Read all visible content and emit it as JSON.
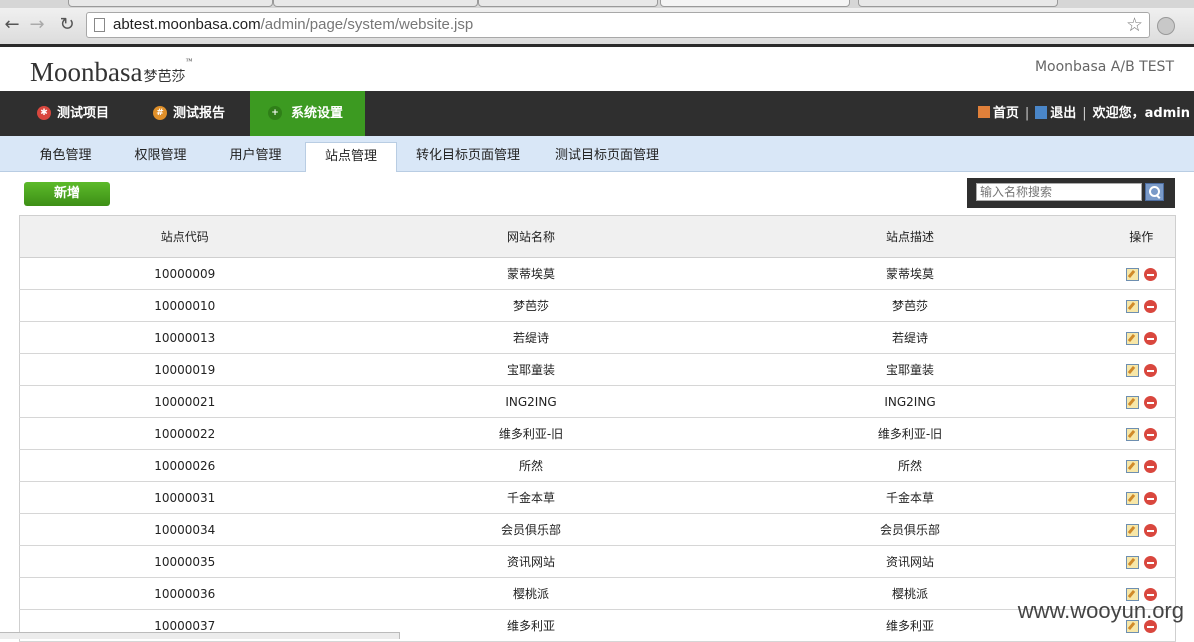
{
  "browser": {
    "tabs": [
      "",
      "",
      "",
      "",
      ""
    ],
    "url_host": "abtest.moonbasa.com",
    "url_path": "/admin/page/system/website.jsp"
  },
  "header": {
    "logo_text": "Moonbasa",
    "logo_cn": "梦芭莎",
    "logo_tm": "™",
    "brand": "Moonbasa A/B TEST"
  },
  "nav": {
    "items": [
      {
        "label": "测试项目",
        "icon": "target-icon",
        "color": "#d9473e"
      },
      {
        "label": "测试报告",
        "icon": "grid-icon",
        "color": "#e0902a"
      },
      {
        "label": "系统设置",
        "icon": "gear-icon",
        "color": "#2f7f18"
      }
    ],
    "active": "系统设置",
    "home": "首页",
    "logout": "退出",
    "welcome": "欢迎您，admin"
  },
  "subnav": {
    "tabs": [
      "角色管理",
      "权限管理",
      "用户管理",
      "站点管理",
      "转化目标页面管理",
      "测试目标页面管理"
    ],
    "active": "站点管理"
  },
  "actions": {
    "add_label": "新增",
    "search_placeholder": "输入名称搜索"
  },
  "table": {
    "headers": [
      "站点代码",
      "网站名称",
      "站点描述",
      "操作"
    ],
    "rows": [
      [
        "10000009",
        "蒙蒂埃莫",
        "蒙蒂埃莫"
      ],
      [
        "10000010",
        "梦芭莎",
        "梦芭莎"
      ],
      [
        "10000013",
        "若缇诗",
        "若缇诗"
      ],
      [
        "10000019",
        "宝耶童装",
        "宝耶童装"
      ],
      [
        "10000021",
        "ING2ING",
        "ING2ING"
      ],
      [
        "10000022",
        "维多利亚-旧",
        "维多利亚-旧"
      ],
      [
        "10000026",
        "所然",
        "所然"
      ],
      [
        "10000031",
        "千金本草",
        "千金本草"
      ],
      [
        "10000034",
        "会员俱乐部",
        "会员俱乐部"
      ],
      [
        "10000035",
        "资讯网站",
        "资讯网站"
      ],
      [
        "10000036",
        "樱桃派",
        "樱桃派"
      ],
      [
        "10000037",
        "维多利亚",
        "维多利亚"
      ]
    ]
  },
  "watermark": "www.wooyun.org",
  "colors": {
    "nav_bg": "#2f2f2f",
    "nav_active": "#3c9a21",
    "subnav_bg": "#d9e7f7",
    "add_button": "#4aa520"
  }
}
